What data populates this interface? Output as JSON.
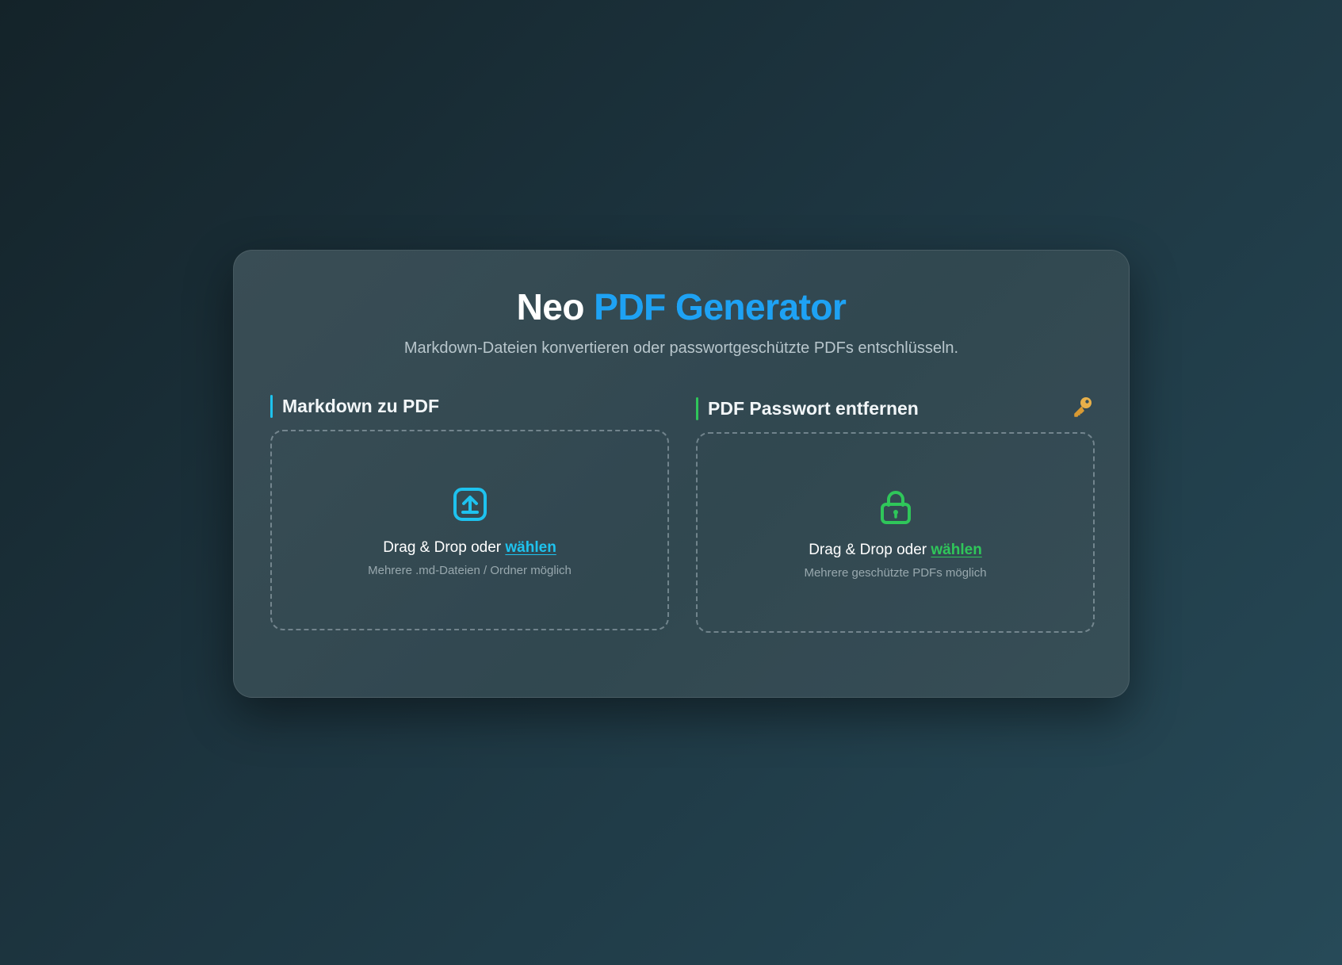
{
  "header": {
    "title_part1": "Neo",
    "title_part2": "PDF Generator",
    "subtitle": "Markdown-Dateien konvertieren oder passwortgeschützte PDFs entschlüsseln."
  },
  "markdown_panel": {
    "title": "Markdown zu PDF",
    "accent_color": "#1ec2ee",
    "icon": "upload-icon",
    "dropzone_text": "Drag & Drop oder ",
    "dropzone_link": "wählen",
    "dropzone_hint": "Mehrere .md-Dateien / Ordner möglich"
  },
  "password_panel": {
    "title": "PDF Passwort entfernen",
    "accent_color": "#2fc65a",
    "header_icon": "key-icon",
    "icon": "lock-icon",
    "dropzone_text": "Drag & Drop oder ",
    "dropzone_link": "wählen",
    "dropzone_hint": "Mehrere geschützte PDFs möglich"
  },
  "colors": {
    "brand_blue": "#1ea2f4",
    "markdown_accent": "#1ec2ee",
    "password_accent": "#2fc65a",
    "key_color": "#e8b04a"
  }
}
